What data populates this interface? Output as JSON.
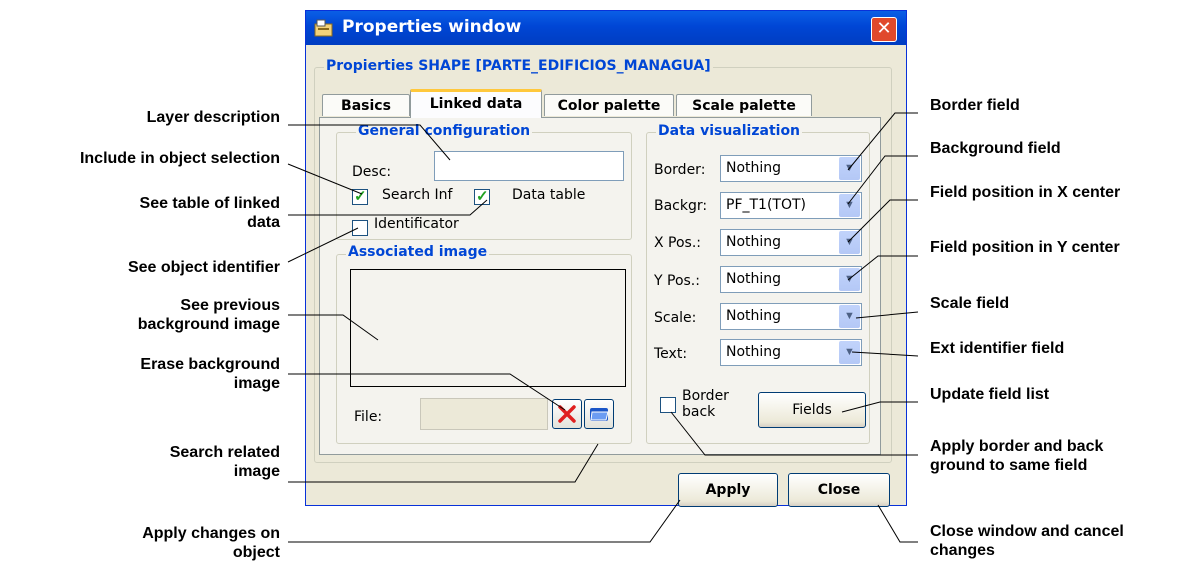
{
  "window": {
    "title": "Properties window",
    "close_glyph": "✕",
    "group_title": "Propierties SHAPE [PARTE_EDIFICIOS_MANAGUA]"
  },
  "tabs": [
    {
      "label": "Basics",
      "active": false
    },
    {
      "label": "Linked data",
      "active": true
    },
    {
      "label": "Color palette",
      "active": false
    },
    {
      "label": "Scale palette",
      "active": false
    }
  ],
  "general": {
    "legend": "General configuration",
    "desc_label": "Desc:",
    "desc_value": "",
    "search_inf_label": "Search Inf",
    "search_inf_checked": true,
    "data_table_label": "Data table",
    "data_table_checked": true,
    "identificator_label": "Identificator",
    "identificator_checked": false
  },
  "image": {
    "legend": "Associated image",
    "file_label": "File:",
    "file_value": "",
    "erase_icon": "red-x-icon",
    "search_icon": "folder-icon"
  },
  "visualization": {
    "legend": "Data visualization",
    "rows": [
      {
        "label": "Border:",
        "value": "Nothing"
      },
      {
        "label": "Backgr:",
        "value": "PF_T1(TOT)"
      },
      {
        "label": "X Pos.:",
        "value": "Nothing"
      },
      {
        "label": "Y Pos.:",
        "value": "Nothing"
      },
      {
        "label": "Scale:",
        "value": "Nothing"
      },
      {
        "label": "Text:",
        "value": "Nothing"
      }
    ],
    "border_back_label_1": "Border",
    "border_back_label_2": "back",
    "border_back_checked": false,
    "fields_button": "Fields"
  },
  "buttons": {
    "apply": "Apply",
    "close": "Close"
  },
  "annotations": {
    "layer_description": "Layer description",
    "include_selection": "Include in object selection",
    "see_table_1": "See table of linked",
    "see_table_2": "data",
    "see_identifier": "See object identifier",
    "see_previous_1": "See previous",
    "see_previous_2": "background image",
    "erase_bg_1": "Erase background",
    "erase_bg_2": "image",
    "search_related_1": "Search related",
    "search_related_2": "image",
    "apply_changes_1": "Apply changes on",
    "apply_changes_2": "object",
    "border_field": "Border field",
    "background_field": "Background field",
    "xpos_field": "Field position in X center",
    "ypos_field": "Field position in Y center",
    "scale_field": "Scale field",
    "ext_identifier": "Ext identifier field",
    "update_list": "Update field list",
    "apply_border_1": "Apply border and back",
    "apply_border_2": "ground to same field",
    "close_cancel_1": "Close window and cancel",
    "close_cancel_2": "changes"
  }
}
